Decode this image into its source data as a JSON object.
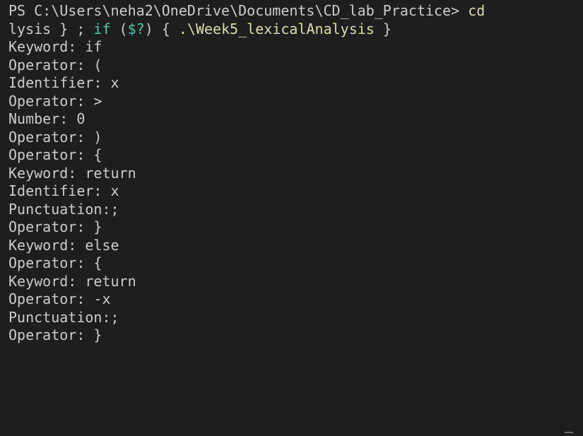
{
  "terminal": {
    "command_lines": [
      {
        "segments": [
          {
            "text": "PS C:\\Users\\neha2\\OneDrive\\Documents\\CD_lab_Practice> ",
            "color": "plain"
          },
          {
            "text": "cd",
            "color": "yellow"
          }
        ]
      },
      {
        "segments": [
          {
            "text": "lysis } ; ",
            "color": "plain"
          },
          {
            "text": "if",
            "color": "green"
          },
          {
            "text": " (",
            "color": "plain"
          },
          {
            "text": "$?",
            "color": "green"
          },
          {
            "text": ") { ",
            "color": "plain"
          },
          {
            "text": ".\\Week5_lexicalAnalysis",
            "color": "yellow"
          },
          {
            "text": " }",
            "color": "plain"
          }
        ]
      }
    ],
    "output_lines": [
      "Keyword: if",
      "Operator: (",
      "Identifier: x",
      "Operator: >",
      "Number: 0",
      "Operator: )",
      "Operator: {",
      "Keyword: return",
      "Identifier: x",
      "Punctuation:;",
      "Operator: }",
      "Keyword: else",
      "Operator: {",
      "Keyword: return",
      "Operator: -x",
      "Punctuation:;",
      "Operator: }"
    ],
    "colors": {
      "background": "#1e1e1e",
      "text": "#cccccc",
      "yellow": "#dcdcaa",
      "green": "#4ec9b0"
    }
  }
}
